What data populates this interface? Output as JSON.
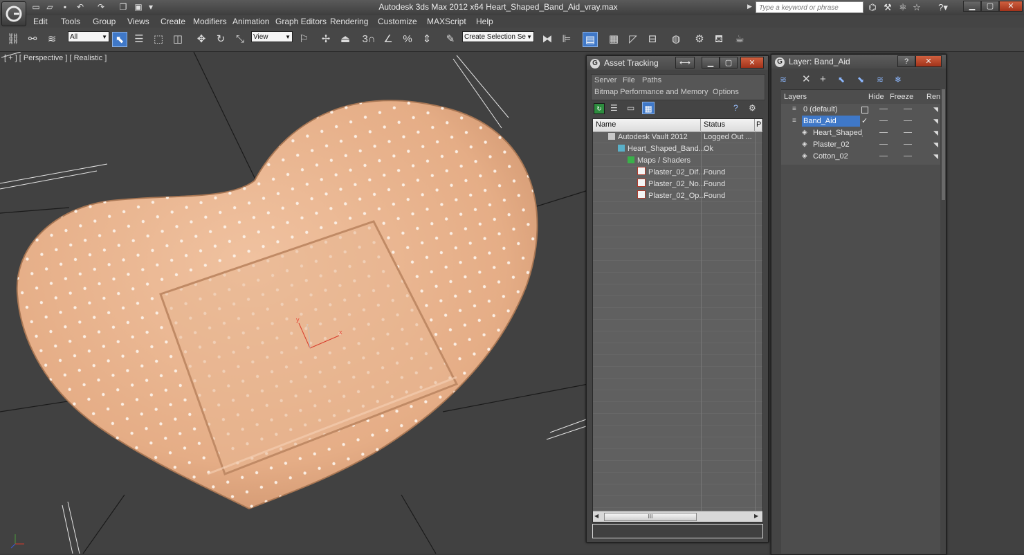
{
  "window": {
    "title": "Autodesk 3ds Max  2012 x64      Heart_Shaped_Band_Aid_vray.max",
    "search_placeholder": "Type a keyword or phrase"
  },
  "menu": [
    "Edit",
    "Tools",
    "Group",
    "Views",
    "Create",
    "Modifiers",
    "Animation",
    "Graph Editors",
    "Rendering",
    "Customize",
    "MAXScript",
    "Help"
  ],
  "toolbar": {
    "selection_filter": "All",
    "reference_coord": "View",
    "named_selection": "Create Selection Se"
  },
  "viewport": {
    "label": "[ + ] [ Perspective ] [ Realistic ]",
    "axis_labels": {
      "x": "x",
      "y": "y",
      "z": "z"
    }
  },
  "asset_tracking": {
    "title": "Asset Tracking",
    "menu_row1": [
      "Server",
      "File",
      "Paths"
    ],
    "menu_row2": [
      "Bitmap Performance and Memory",
      "Options"
    ],
    "columns": [
      "Name",
      "Status",
      "P"
    ],
    "rows": [
      {
        "name": "Autodesk Vault 2012",
        "status": "Logged Out ...",
        "icon": "vault-icon",
        "indent": 0
      },
      {
        "name": "Heart_Shaped_Band...",
        "status": "Ok",
        "icon": "max-file-icon",
        "indent": 1
      },
      {
        "name": "Maps / Shaders",
        "status": "",
        "icon": "maps-icon",
        "indent": 2
      },
      {
        "name": "Plaster_02_Dif...",
        "status": "Found",
        "icon": "bitmap-icon",
        "indent": 3
      },
      {
        "name": "Plaster_02_No...",
        "status": "Found",
        "icon": "bitmap-icon",
        "indent": 3
      },
      {
        "name": "Plaster_02_Op...",
        "status": "Found",
        "icon": "bitmap-icon",
        "indent": 3
      }
    ],
    "scroll_grip": "III"
  },
  "layer_panel": {
    "title": "Layer: Band_Aid",
    "columns": [
      "Layers",
      "Hide",
      "Freeze",
      "Ren"
    ],
    "rows": [
      {
        "name": "0 (default)",
        "selected": false,
        "indent": 0
      },
      {
        "name": "Band_Aid",
        "selected": true,
        "indent": 0
      },
      {
        "name": "Heart_Shaped_E",
        "selected": false,
        "indent": 1
      },
      {
        "name": "Plaster_02",
        "selected": false,
        "indent": 1
      },
      {
        "name": "Cotton_02",
        "selected": false,
        "indent": 1
      }
    ]
  },
  "colors": {
    "accent": "#3f78c8",
    "bandaid": "#e9b48f",
    "viewport_bg": "#414141"
  }
}
